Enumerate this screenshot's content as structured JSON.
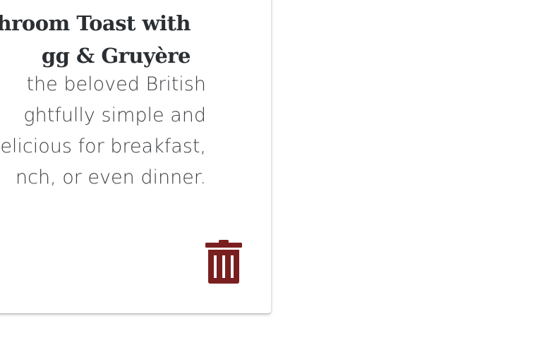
{
  "card": {
    "title_lines": [
      "ushroom Toast with",
      "gg & Gruyère"
    ],
    "description_lines": [
      "the beloved British",
      "ghtfully simple and",
      "elicious for breakfast,",
      "nch, or even dinner."
    ],
    "delete_icon": "trash-icon",
    "delete_color": "#7a1f1f"
  }
}
